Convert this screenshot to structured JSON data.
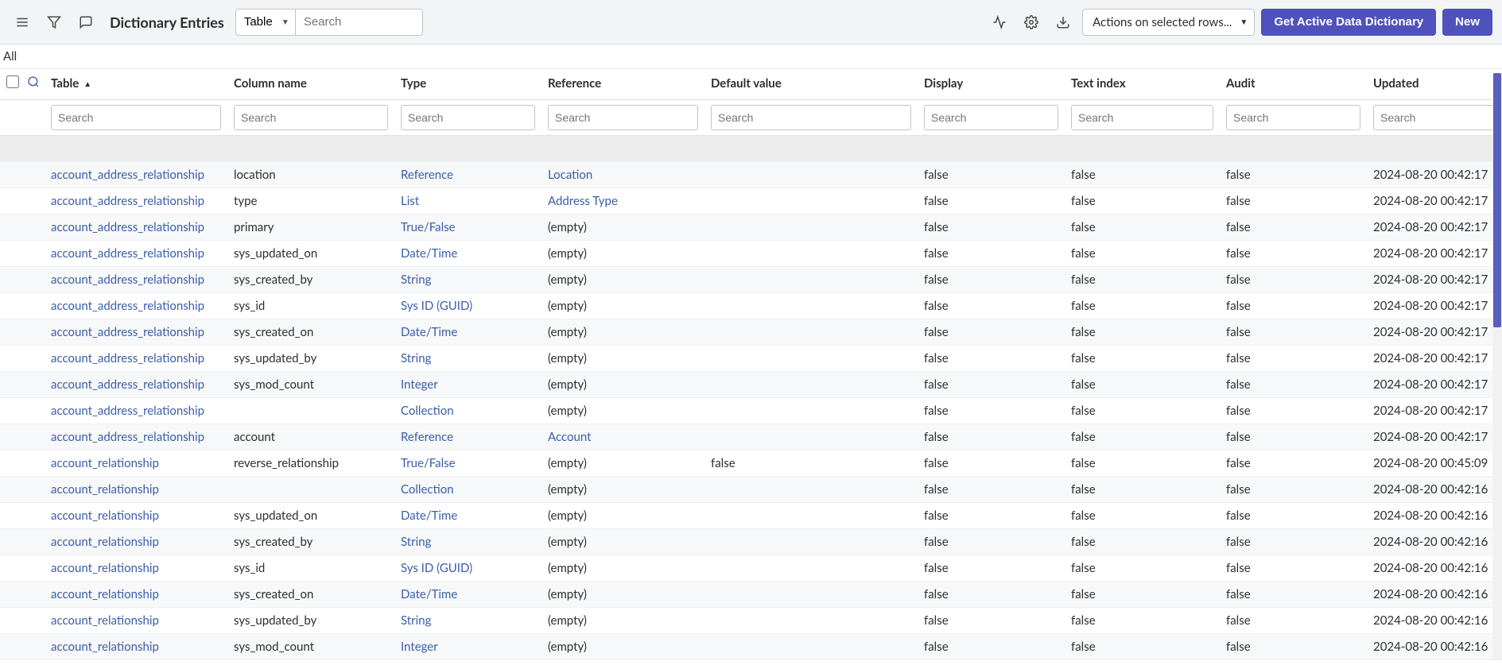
{
  "toolbar": {
    "title": "Dictionary Entries",
    "filter_field_options": [
      "Table"
    ],
    "filter_field_selected": "Table",
    "search_placeholder": "Search",
    "actions_label": "Actions on selected rows...",
    "get_active_label": "Get Active Data Dictionary",
    "new_label": "New"
  },
  "subbar": {
    "text": "All"
  },
  "columns": [
    {
      "key": "table",
      "label": "Table",
      "sorted": true
    },
    {
      "key": "column_name",
      "label": "Column name"
    },
    {
      "key": "type",
      "label": "Type"
    },
    {
      "key": "reference",
      "label": "Reference"
    },
    {
      "key": "default_value",
      "label": "Default value"
    },
    {
      "key": "display",
      "label": "Display"
    },
    {
      "key": "text_index",
      "label": "Text index"
    },
    {
      "key": "audit",
      "label": "Audit"
    },
    {
      "key": "updated",
      "label": "Updated"
    }
  ],
  "col_search_placeholder": "Search",
  "rows": [
    {
      "table": "account_address_relationship",
      "column_name": "location",
      "type": "Reference",
      "type_link": true,
      "reference": "Location",
      "reference_link": true,
      "default_value": "",
      "display": "false",
      "text_index": "false",
      "audit": "false",
      "updated": "2024-08-20 00:42:17"
    },
    {
      "table": "account_address_relationship",
      "column_name": "type",
      "type": "List",
      "type_link": true,
      "reference": "Address Type",
      "reference_link": true,
      "default_value": "",
      "display": "false",
      "text_index": "false",
      "audit": "false",
      "updated": "2024-08-20 00:42:17"
    },
    {
      "table": "account_address_relationship",
      "column_name": "primary",
      "type": "True/False",
      "type_link": true,
      "reference": "(empty)",
      "reference_link": false,
      "default_value": "",
      "display": "false",
      "text_index": "false",
      "audit": "false",
      "updated": "2024-08-20 00:42:17"
    },
    {
      "table": "account_address_relationship",
      "column_name": "sys_updated_on",
      "type": "Date/Time",
      "type_link": true,
      "reference": "(empty)",
      "reference_link": false,
      "default_value": "",
      "display": "false",
      "text_index": "false",
      "audit": "false",
      "updated": "2024-08-20 00:42:17"
    },
    {
      "table": "account_address_relationship",
      "column_name": "sys_created_by",
      "type": "String",
      "type_link": true,
      "reference": "(empty)",
      "reference_link": false,
      "default_value": "",
      "display": "false",
      "text_index": "false",
      "audit": "false",
      "updated": "2024-08-20 00:42:17"
    },
    {
      "table": "account_address_relationship",
      "column_name": "sys_id",
      "type": "Sys ID (GUID)",
      "type_link": true,
      "reference": "(empty)",
      "reference_link": false,
      "default_value": "",
      "display": "false",
      "text_index": "false",
      "audit": "false",
      "updated": "2024-08-20 00:42:17"
    },
    {
      "table": "account_address_relationship",
      "column_name": "sys_created_on",
      "type": "Date/Time",
      "type_link": true,
      "reference": "(empty)",
      "reference_link": false,
      "default_value": "",
      "display": "false",
      "text_index": "false",
      "audit": "false",
      "updated": "2024-08-20 00:42:17"
    },
    {
      "table": "account_address_relationship",
      "column_name": "sys_updated_by",
      "type": "String",
      "type_link": true,
      "reference": "(empty)",
      "reference_link": false,
      "default_value": "",
      "display": "false",
      "text_index": "false",
      "audit": "false",
      "updated": "2024-08-20 00:42:17"
    },
    {
      "table": "account_address_relationship",
      "column_name": "sys_mod_count",
      "type": "Integer",
      "type_link": true,
      "reference": "(empty)",
      "reference_link": false,
      "default_value": "",
      "display": "false",
      "text_index": "false",
      "audit": "false",
      "updated": "2024-08-20 00:42:17"
    },
    {
      "table": "account_address_relationship",
      "column_name": "",
      "type": "Collection",
      "type_link": true,
      "reference": "(empty)",
      "reference_link": false,
      "default_value": "",
      "display": "false",
      "text_index": "false",
      "audit": "false",
      "updated": "2024-08-20 00:42:17"
    },
    {
      "table": "account_address_relationship",
      "column_name": "account",
      "type": "Reference",
      "type_link": true,
      "reference": "Account",
      "reference_link": true,
      "default_value": "",
      "display": "false",
      "text_index": "false",
      "audit": "false",
      "updated": "2024-08-20 00:42:17"
    },
    {
      "table": "account_relationship",
      "column_name": "reverse_relationship",
      "type": "True/False",
      "type_link": true,
      "reference": "(empty)",
      "reference_link": false,
      "default_value": "false",
      "display": "false",
      "text_index": "false",
      "audit": "false",
      "updated": "2024-08-20 00:45:09"
    },
    {
      "table": "account_relationship",
      "column_name": "",
      "type": "Collection",
      "type_link": true,
      "reference": "(empty)",
      "reference_link": false,
      "default_value": "",
      "display": "false",
      "text_index": "false",
      "audit": "false",
      "updated": "2024-08-20 00:42:16"
    },
    {
      "table": "account_relationship",
      "column_name": "sys_updated_on",
      "type": "Date/Time",
      "type_link": true,
      "reference": "(empty)",
      "reference_link": false,
      "default_value": "",
      "display": "false",
      "text_index": "false",
      "audit": "false",
      "updated": "2024-08-20 00:42:16"
    },
    {
      "table": "account_relationship",
      "column_name": "sys_created_by",
      "type": "String",
      "type_link": true,
      "reference": "(empty)",
      "reference_link": false,
      "default_value": "",
      "display": "false",
      "text_index": "false",
      "audit": "false",
      "updated": "2024-08-20 00:42:16"
    },
    {
      "table": "account_relationship",
      "column_name": "sys_id",
      "type": "Sys ID (GUID)",
      "type_link": true,
      "reference": "(empty)",
      "reference_link": false,
      "default_value": "",
      "display": "false",
      "text_index": "false",
      "audit": "false",
      "updated": "2024-08-20 00:42:16"
    },
    {
      "table": "account_relationship",
      "column_name": "sys_created_on",
      "type": "Date/Time",
      "type_link": true,
      "reference": "(empty)",
      "reference_link": false,
      "default_value": "",
      "display": "false",
      "text_index": "false",
      "audit": "false",
      "updated": "2024-08-20 00:42:16"
    },
    {
      "table": "account_relationship",
      "column_name": "sys_updated_by",
      "type": "String",
      "type_link": true,
      "reference": "(empty)",
      "reference_link": false,
      "default_value": "",
      "display": "false",
      "text_index": "false",
      "audit": "false",
      "updated": "2024-08-20 00:42:16"
    },
    {
      "table": "account_relationship",
      "column_name": "sys_mod_count",
      "type": "Integer",
      "type_link": true,
      "reference": "(empty)",
      "reference_link": false,
      "default_value": "",
      "display": "false",
      "text_index": "false",
      "audit": "false",
      "updated": "2024-08-20 00:42:16"
    }
  ]
}
